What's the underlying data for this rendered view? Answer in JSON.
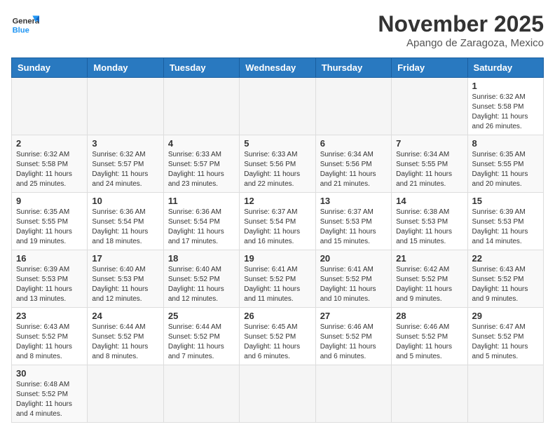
{
  "header": {
    "logo_general": "General",
    "logo_blue": "Blue",
    "month_title": "November 2025",
    "location": "Apango de Zaragoza, Mexico"
  },
  "weekdays": [
    "Sunday",
    "Monday",
    "Tuesday",
    "Wednesday",
    "Thursday",
    "Friday",
    "Saturday"
  ],
  "weeks": [
    [
      {
        "day": "",
        "info": ""
      },
      {
        "day": "",
        "info": ""
      },
      {
        "day": "",
        "info": ""
      },
      {
        "day": "",
        "info": ""
      },
      {
        "day": "",
        "info": ""
      },
      {
        "day": "",
        "info": ""
      },
      {
        "day": "1",
        "info": "Sunrise: 6:32 AM\nSunset: 5:58 PM\nDaylight: 11 hours\nand 26 minutes."
      }
    ],
    [
      {
        "day": "2",
        "info": "Sunrise: 6:32 AM\nSunset: 5:58 PM\nDaylight: 11 hours\nand 25 minutes."
      },
      {
        "day": "3",
        "info": "Sunrise: 6:32 AM\nSunset: 5:57 PM\nDaylight: 11 hours\nand 24 minutes."
      },
      {
        "day": "4",
        "info": "Sunrise: 6:33 AM\nSunset: 5:57 PM\nDaylight: 11 hours\nand 23 minutes."
      },
      {
        "day": "5",
        "info": "Sunrise: 6:33 AM\nSunset: 5:56 PM\nDaylight: 11 hours\nand 22 minutes."
      },
      {
        "day": "6",
        "info": "Sunrise: 6:34 AM\nSunset: 5:56 PM\nDaylight: 11 hours\nand 21 minutes."
      },
      {
        "day": "7",
        "info": "Sunrise: 6:34 AM\nSunset: 5:55 PM\nDaylight: 11 hours\nand 21 minutes."
      },
      {
        "day": "8",
        "info": "Sunrise: 6:35 AM\nSunset: 5:55 PM\nDaylight: 11 hours\nand 20 minutes."
      }
    ],
    [
      {
        "day": "9",
        "info": "Sunrise: 6:35 AM\nSunset: 5:55 PM\nDaylight: 11 hours\nand 19 minutes."
      },
      {
        "day": "10",
        "info": "Sunrise: 6:36 AM\nSunset: 5:54 PM\nDaylight: 11 hours\nand 18 minutes."
      },
      {
        "day": "11",
        "info": "Sunrise: 6:36 AM\nSunset: 5:54 PM\nDaylight: 11 hours\nand 17 minutes."
      },
      {
        "day": "12",
        "info": "Sunrise: 6:37 AM\nSunset: 5:54 PM\nDaylight: 11 hours\nand 16 minutes."
      },
      {
        "day": "13",
        "info": "Sunrise: 6:37 AM\nSunset: 5:53 PM\nDaylight: 11 hours\nand 15 minutes."
      },
      {
        "day": "14",
        "info": "Sunrise: 6:38 AM\nSunset: 5:53 PM\nDaylight: 11 hours\nand 15 minutes."
      },
      {
        "day": "15",
        "info": "Sunrise: 6:39 AM\nSunset: 5:53 PM\nDaylight: 11 hours\nand 14 minutes."
      }
    ],
    [
      {
        "day": "16",
        "info": "Sunrise: 6:39 AM\nSunset: 5:53 PM\nDaylight: 11 hours\nand 13 minutes."
      },
      {
        "day": "17",
        "info": "Sunrise: 6:40 AM\nSunset: 5:53 PM\nDaylight: 11 hours\nand 12 minutes."
      },
      {
        "day": "18",
        "info": "Sunrise: 6:40 AM\nSunset: 5:52 PM\nDaylight: 11 hours\nand 12 minutes."
      },
      {
        "day": "19",
        "info": "Sunrise: 6:41 AM\nSunset: 5:52 PM\nDaylight: 11 hours\nand 11 minutes."
      },
      {
        "day": "20",
        "info": "Sunrise: 6:41 AM\nSunset: 5:52 PM\nDaylight: 11 hours\nand 10 minutes."
      },
      {
        "day": "21",
        "info": "Sunrise: 6:42 AM\nSunset: 5:52 PM\nDaylight: 11 hours\nand 9 minutes."
      },
      {
        "day": "22",
        "info": "Sunrise: 6:43 AM\nSunset: 5:52 PM\nDaylight: 11 hours\nand 9 minutes."
      }
    ],
    [
      {
        "day": "23",
        "info": "Sunrise: 6:43 AM\nSunset: 5:52 PM\nDaylight: 11 hours\nand 8 minutes."
      },
      {
        "day": "24",
        "info": "Sunrise: 6:44 AM\nSunset: 5:52 PM\nDaylight: 11 hours\nand 8 minutes."
      },
      {
        "day": "25",
        "info": "Sunrise: 6:44 AM\nSunset: 5:52 PM\nDaylight: 11 hours\nand 7 minutes."
      },
      {
        "day": "26",
        "info": "Sunrise: 6:45 AM\nSunset: 5:52 PM\nDaylight: 11 hours\nand 6 minutes."
      },
      {
        "day": "27",
        "info": "Sunrise: 6:46 AM\nSunset: 5:52 PM\nDaylight: 11 hours\nand 6 minutes."
      },
      {
        "day": "28",
        "info": "Sunrise: 6:46 AM\nSunset: 5:52 PM\nDaylight: 11 hours\nand 5 minutes."
      },
      {
        "day": "29",
        "info": "Sunrise: 6:47 AM\nSunset: 5:52 PM\nDaylight: 11 hours\nand 5 minutes."
      }
    ],
    [
      {
        "day": "30",
        "info": "Sunrise: 6:48 AM\nSunset: 5:52 PM\nDaylight: 11 hours\nand 4 minutes."
      },
      {
        "day": "",
        "info": ""
      },
      {
        "day": "",
        "info": ""
      },
      {
        "day": "",
        "info": ""
      },
      {
        "day": "",
        "info": ""
      },
      {
        "day": "",
        "info": ""
      },
      {
        "day": "",
        "info": ""
      }
    ]
  ]
}
